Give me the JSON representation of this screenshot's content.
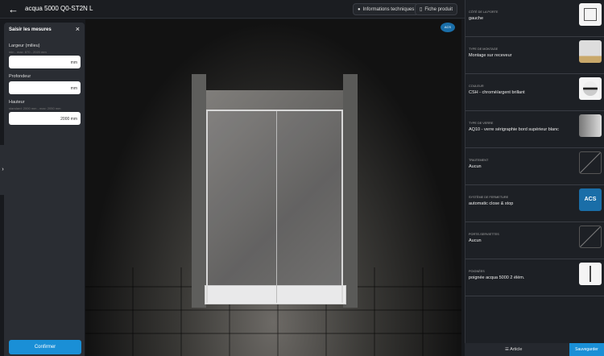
{
  "header": {
    "title": "acqua 5000 Q0-ST2N L",
    "info_button": "Informations techniques",
    "product_sheet_button": "Fiche produit"
  },
  "measures": {
    "title": "Saisir les mesures",
    "fields": [
      {
        "label": "Largeur (milieu)",
        "hint": "min - max: 870 - 2020 mm",
        "value": "",
        "unit": "mm"
      },
      {
        "label": "Profondeur",
        "hint": "",
        "value": "",
        "unit": "mm"
      },
      {
        "label": "Hauteur",
        "hint": "standard: 2000 mm - max: 2050 mm",
        "value": "2000",
        "unit": "mm"
      }
    ],
    "confirm": "Confirmer"
  },
  "viewport": {
    "badge": "ACS"
  },
  "options": [
    {
      "key": "Côté de la porte",
      "value": "gauche",
      "thumb": "door-side"
    },
    {
      "key": "Type de montage",
      "value": "Montage sur receveur",
      "thumb": "mounting"
    },
    {
      "key": "Couleur",
      "value": "CSH - chromé/argent brillant",
      "thumb": "chrome"
    },
    {
      "key": "Type de verre",
      "value": "AQ10 - verre sérigraphie bord supérieur blanc",
      "thumb": "glass"
    },
    {
      "key": "Traitement",
      "value": "Aucun",
      "thumb": "none"
    },
    {
      "key": "Système de fermeture",
      "value": "automatic close & stop",
      "thumb": "ACS"
    },
    {
      "key": "Porte-serviettes",
      "value": "Aucun",
      "thumb": "none"
    },
    {
      "key": "Poignées",
      "value": "poignée acqua 5000 2 élém.",
      "thumb": "handle"
    }
  ],
  "footer": {
    "article": "Article",
    "save": "Sauvegarder"
  },
  "colors": {
    "accent": "#1a8fd6",
    "panel": "#2a2d33"
  }
}
